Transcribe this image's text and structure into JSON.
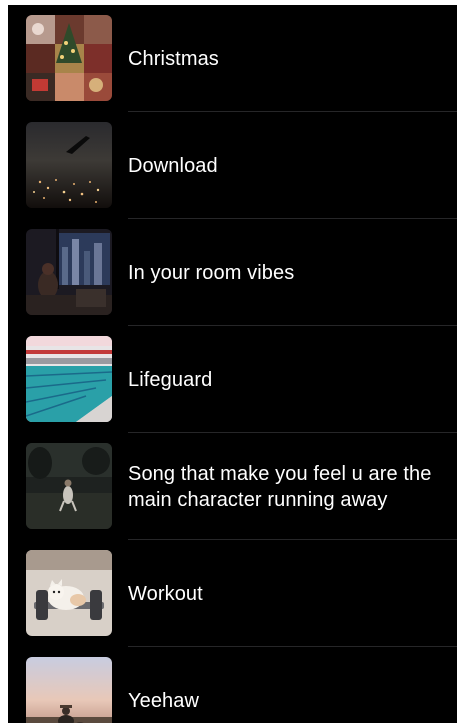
{
  "playlists": [
    {
      "title": "Christmas",
      "thumb": "christmas-collage"
    },
    {
      "title": "Download",
      "thumb": "night-city-from-plane"
    },
    {
      "title": "In your room vibes",
      "thumb": "window-city-view"
    },
    {
      "title": "Lifeguard",
      "thumb": "swimming-pool-lanes"
    },
    {
      "title": "Song that make you feel u are the main character running away",
      "thumb": "dark-forest-figure"
    },
    {
      "title": "Workout",
      "thumb": "kitten-on-dumbbell"
    },
    {
      "title": "Yeehaw",
      "thumb": "sunset-riders"
    }
  ]
}
